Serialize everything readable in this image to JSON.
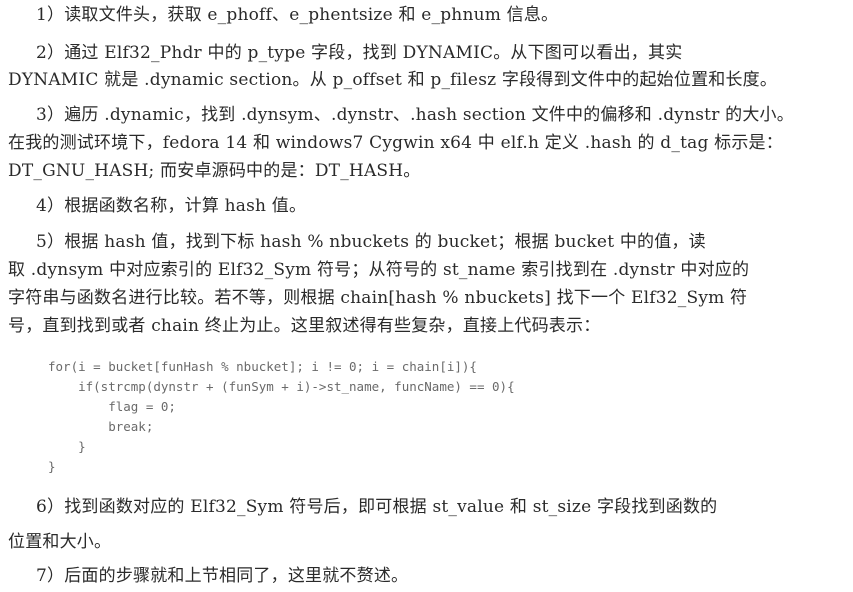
{
  "paragraphs": {
    "p1": "1）读取文件头，获取 e_phoff、e_phentsize 和 e_phnum 信息。",
    "p2_l1": "2）通过 Elf32_Phdr 中的 p_type 字段，找到 DYNAMIC。从下图可以看出，其实",
    "p2_l2": "DYNAMIC 就是 .dynamic section。从 p_offset 和 p_filesz 字段得到文件中的起始位置和长度。",
    "p3_l1": "3）遍历 .dynamic，找到 .dynsym、.dynstr、.hash section 文件中的偏移和 .dynstr 的大小。",
    "p3_l2": "在我的测试环境下，fedora 14 和 windows7 Cygwin x64 中 elf.h 定义 .hash 的 d_tag 标示是：",
    "p3_l3": "DT_GNU_HASH; 而安卓源码中的是：DT_HASH。",
    "p4": "4）根据函数名称，计算 hash 值。",
    "p5_l1": "5）根据 hash 值，找到下标 hash % nbuckets 的 bucket；根据 bucket 中的值，读",
    "p5_l2": "取 .dynsym 中对应索引的 Elf32_Sym 符号；从符号的 st_name 索引找到在 .dynstr 中对应的",
    "p5_l3": "字符串与函数名进行比较。若不等，则根据 chain[hash % nbuckets] 找下一个 Elf32_Sym 符",
    "p5_l4": "号，直到找到或者 chain 终止为止。这里叙述得有些复杂，直接上代码表示：",
    "p6_l1": "6）找到函数对应的 Elf32_Sym 符号后，即可根据 st_value 和 st_size 字段找到函数的",
    "p6_l2": "位置和大小。",
    "p7": "7）后面的步骤就和上节相同了，这里就不赘述。"
  },
  "code": {
    "l1": "for(i = bucket[funHash % nbucket]; i != 0; i = chain[i]){",
    "l2": "    if(strcmp(dynstr + (funSym + i)->st_name, funcName) == 0){",
    "l3": "        flag = 0;",
    "l4": "        break;",
    "l5": "    }",
    "l6": "}"
  }
}
